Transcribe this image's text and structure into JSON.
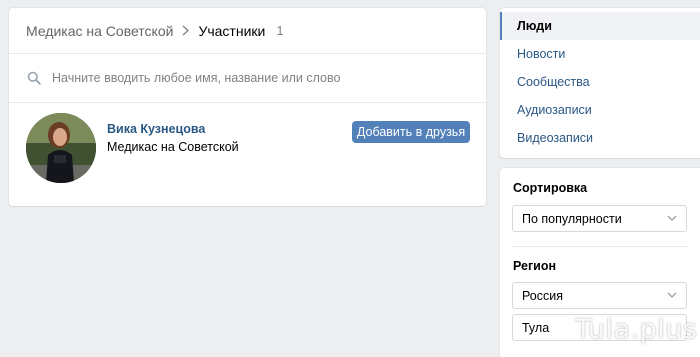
{
  "main": {
    "breadcrumb": {
      "parent": "Медикас на Советской",
      "current": "Участники",
      "count": "1"
    },
    "search": {
      "placeholder": "Начните вводить любое имя, название или слово"
    },
    "member": {
      "name": "Вика Кузнецова",
      "subtitle": "Медикас на Советской",
      "add_label": "Добавить в друзья"
    }
  },
  "nav": {
    "items": [
      {
        "label": "Люди"
      },
      {
        "label": "Новости"
      },
      {
        "label": "Сообщества"
      },
      {
        "label": "Аудиозаписи"
      },
      {
        "label": "Видеозаписи"
      }
    ]
  },
  "filters": {
    "sort_title": "Сортировка",
    "sort_value": "По популярности",
    "region_title": "Регион",
    "country_value": "Россия",
    "city_value": "Тула"
  },
  "watermark": "Tula.plus",
  "colors": {
    "accent": "#5181b8",
    "link": "#2a5885",
    "background": "#edeef0"
  }
}
